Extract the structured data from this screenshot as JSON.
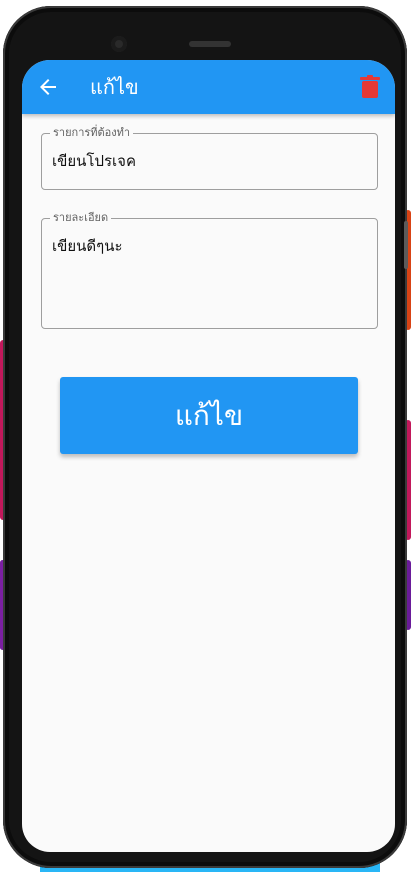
{
  "appbar": {
    "title": "แก้ไข",
    "back_icon": "arrow-back-icon",
    "delete_icon": "trash-icon",
    "delete_color": "#e53935",
    "color": "#2196f3"
  },
  "form": {
    "todo_label": "รายการที่ต้องทำ",
    "todo_value": "เขียนโปรเจค",
    "detail_label": "รายละเอียด",
    "detail_value": "เขียนดีๆนะ"
  },
  "submit": {
    "label": "แก้ไข",
    "color": "#2196f3"
  }
}
